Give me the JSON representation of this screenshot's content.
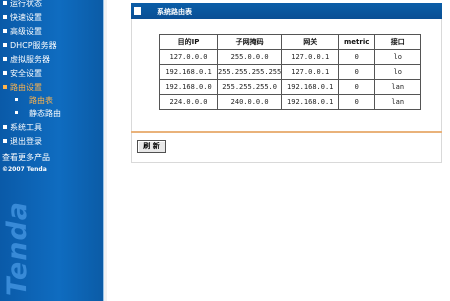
{
  "sidebar": {
    "watermark": "Tenda",
    "items": [
      {
        "label": "运行状态"
      },
      {
        "label": "快速设置"
      },
      {
        "label": "高级设置"
      },
      {
        "label": "DHCP服务器"
      },
      {
        "label": "虚拟服务器"
      },
      {
        "label": "安全设置"
      },
      {
        "label": "路由设置"
      }
    ],
    "sub_items": [
      {
        "label": "路由表"
      },
      {
        "label": "静态路由"
      }
    ],
    "items_after": [
      {
        "label": "系统工具"
      },
      {
        "label": "退出登录"
      }
    ],
    "more_link": "查看更多产品",
    "copyright": "©2007 Tenda"
  },
  "main": {
    "title": "系统路由表",
    "table": {
      "headers": [
        "目的IP",
        "子网掩码",
        "网关",
        "metric",
        "接口"
      ],
      "rows": [
        [
          "127.0.0.0",
          "255.0.0.0",
          "127.0.0.1",
          "0",
          "lo"
        ],
        [
          "192.168.0.1",
          "255.255.255.255",
          "127.0.0.1",
          "0",
          "lo"
        ],
        [
          "192.168.0.0",
          "255.255.255.0",
          "192.168.0.1",
          "0",
          "lan"
        ],
        [
          "224.0.0.0",
          "240.0.0.0",
          "192.168.0.1",
          "0",
          "lan"
        ]
      ]
    },
    "refresh_label": "刷 新"
  },
  "colors": {
    "sidebar_blue": "#0f6cc0",
    "title_bar_blue": "#0a4f94",
    "active_orange": "#ffb44c",
    "rule_orange": "#e9b27a"
  }
}
